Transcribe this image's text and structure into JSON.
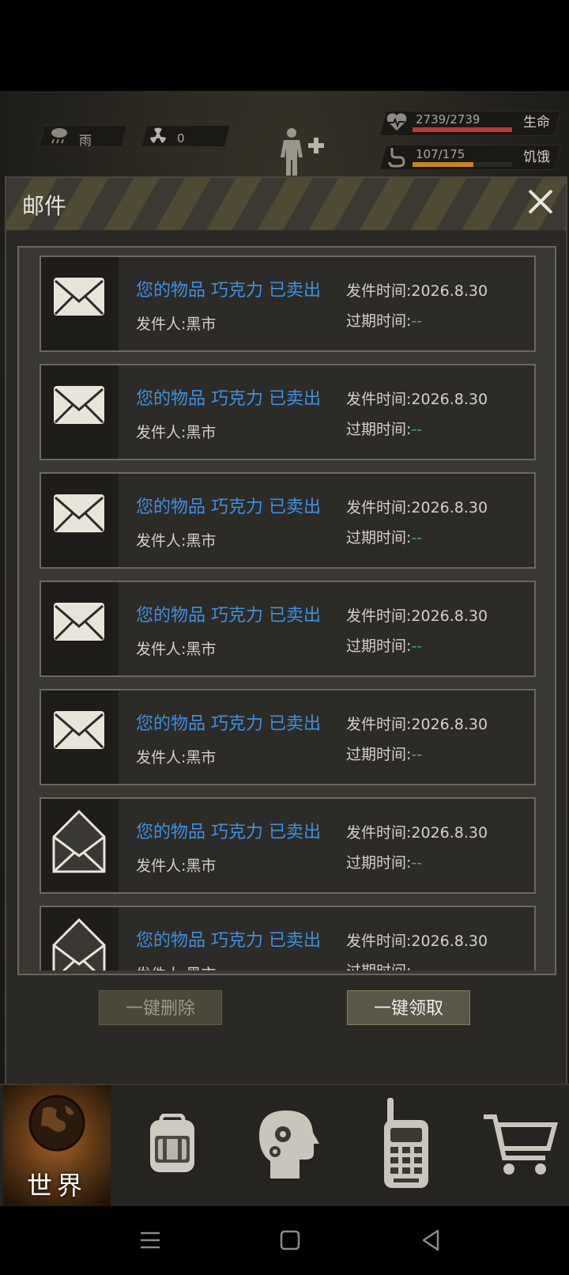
{
  "status": {
    "weather_label": "雨",
    "radiation_value": "0",
    "health_value": "2739/2739",
    "health_label": "生命",
    "health_fraction": 1.0,
    "hunger_value": "107/175",
    "hunger_label": "饥饿",
    "hunger_fraction": 0.61,
    "colors": {
      "health": "#b93a32",
      "hunger": "#c7831f"
    }
  },
  "mail_panel": {
    "title": "邮件",
    "items": [
      {
        "subject": "您的物品 巧克力 已卖出",
        "sender": "发件人:黑市",
        "sent": "发件时间:2026.8.30",
        "expire_label": "过期时间:",
        "expire_value": "--",
        "icon": "envelope-closed-icon"
      },
      {
        "subject": "您的物品 巧克力 已卖出",
        "sender": "发件人:黑市",
        "sent": "发件时间:2026.8.30",
        "expire_label": "过期时间:",
        "expire_value": "--",
        "icon": "envelope-closed-icon"
      },
      {
        "subject": "您的物品 巧克力 已卖出",
        "sender": "发件人:黑市",
        "sent": "发件时间:2026.8.30",
        "expire_label": "过期时间:",
        "expire_value": "--",
        "icon": "envelope-closed-icon"
      },
      {
        "subject": "您的物品 巧克力 已卖出",
        "sender": "发件人:黑市",
        "sent": "发件时间:2026.8.30",
        "expire_label": "过期时间:",
        "expire_value": "--",
        "icon": "envelope-closed-icon"
      },
      {
        "subject": "您的物品 巧克力 已卖出",
        "sender": "发件人:黑市",
        "sent": "发件时间:2026.8.30",
        "expire_label": "过期时间:",
        "expire_value": "--",
        "icon": "envelope-closed-icon"
      },
      {
        "subject": "您的物品 巧克力 已卖出",
        "sender": "发件人:黑市",
        "sent": "发件时间:2026.8.30",
        "expire_label": "过期时间:",
        "expire_value": "--",
        "icon": "envelope-open-icon"
      },
      {
        "subject": "您的物品 巧克力 已卖出",
        "sender": "发件人:黑市",
        "sent": "发件时间:2026.8.30",
        "expire_label": "过期时间:",
        "expire_value": "--",
        "icon": "envelope-open-icon"
      }
    ],
    "delete_all_label": "一键删除",
    "claim_all_label": "一键领取"
  },
  "bottom_nav": {
    "world_label": "世界",
    "items": [
      "globe-icon",
      "backpack-icon",
      "brain-head-icon",
      "radio-icon",
      "cart-icon"
    ]
  }
}
